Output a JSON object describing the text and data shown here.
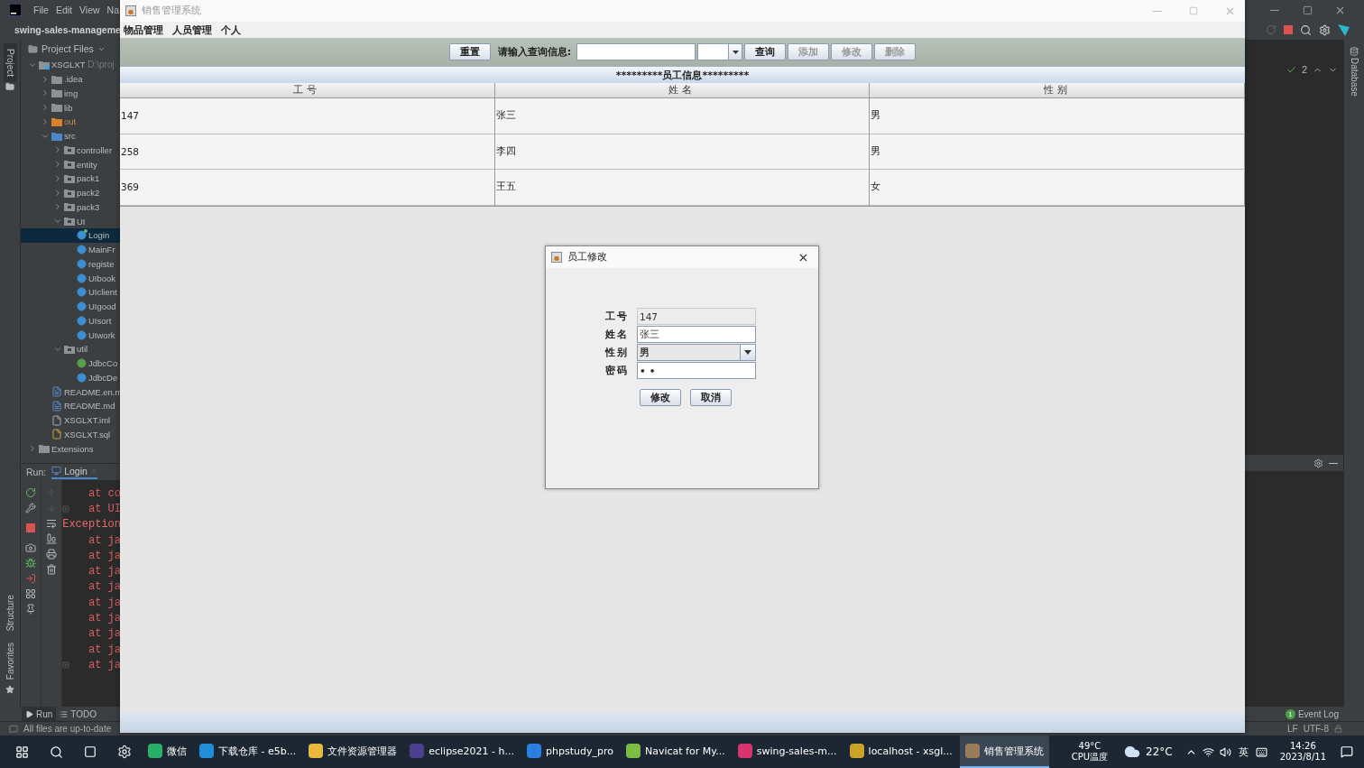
{
  "ide": {
    "menu": [
      "File",
      "Edit",
      "View",
      "Na"
    ],
    "project_title": "swing-sales-manageme",
    "side_tabs": [
      {
        "label": "Project",
        "selected": true
      },
      {
        "label": "Structure",
        "selected": false
      },
      {
        "label": "Favorites",
        "selected": false
      }
    ],
    "project_header": "Project Files",
    "tree": [
      {
        "label": "XSGLXT",
        "path": "D:\\proj",
        "kind": "module",
        "expanded": true,
        "selected": false,
        "children": [
          {
            "label": ".idea",
            "kind": "folder",
            "expanded": false,
            "selected": false
          },
          {
            "label": "img",
            "kind": "folder",
            "expanded": false,
            "selected": false
          },
          {
            "label": "lib",
            "kind": "folder",
            "expanded": false,
            "selected": false
          },
          {
            "label": "out",
            "kind": "excluded",
            "expanded": false,
            "selected": false
          },
          {
            "label": "src",
            "kind": "source",
            "expanded": true,
            "selected": false,
            "children": [
              {
                "label": "controller",
                "kind": "package",
                "expanded": false,
                "selected": false
              },
              {
                "label": "entity",
                "kind": "package",
                "expanded": false,
                "selected": false
              },
              {
                "label": "pack1",
                "kind": "package",
                "expanded": false,
                "selected": false
              },
              {
                "label": "pack2",
                "kind": "package",
                "expanded": false,
                "selected": false
              },
              {
                "label": "pack3",
                "kind": "package",
                "expanded": false,
                "selected": false
              },
              {
                "label": "UI",
                "kind": "package",
                "expanded": true,
                "selected": false,
                "children": [
                  {
                    "label": "Login",
                    "kind": "class",
                    "running": true,
                    "selected": true
                  },
                  {
                    "label": "MainFr",
                    "kind": "class",
                    "running": false,
                    "selected": false
                  },
                  {
                    "label": "registe",
                    "kind": "class",
                    "running": false,
                    "selected": false
                  },
                  {
                    "label": "UIbook",
                    "kind": "class",
                    "running": false,
                    "selected": false
                  },
                  {
                    "label": "UIclient",
                    "kind": "class",
                    "running": false,
                    "selected": false
                  },
                  {
                    "label": "UIgood",
                    "kind": "class",
                    "running": false,
                    "selected": false
                  },
                  {
                    "label": "UIsort",
                    "kind": "class",
                    "running": false,
                    "selected": false
                  },
                  {
                    "label": "UIwork",
                    "kind": "class",
                    "running": false,
                    "selected": false
                  }
                ]
              },
              {
                "label": "util",
                "kind": "package",
                "expanded": true,
                "selected": false,
                "children": [
                  {
                    "label": "JdbcCo",
                    "kind": "class-alt",
                    "running": false,
                    "selected": false
                  },
                  {
                    "label": "JdbcDe",
                    "kind": "class",
                    "running": false,
                    "selected": false
                  }
                ]
              }
            ]
          },
          {
            "label": "README.en.m",
            "kind": "markdown",
            "selected": false
          },
          {
            "label": "README.md",
            "kind": "markdown",
            "selected": false
          },
          {
            "label": "XSGLXT.iml",
            "kind": "iml",
            "selected": false
          },
          {
            "label": "XSGLXT.sql",
            "kind": "sql",
            "selected": false
          }
        ]
      },
      {
        "label": "Extensions",
        "kind": "folder",
        "expanded": false,
        "selected": false
      }
    ],
    "run": {
      "label": "Run:",
      "tab": "Login",
      "console": [
        {
          "kind": "frame",
          "text": "at co",
          "fold": false
        },
        {
          "kind": "frame",
          "text": "at UI",
          "fold": true
        },
        {
          "kind": "exception",
          "text": "Exception",
          "fold": false
        },
        {
          "kind": "frame",
          "text": "at ja",
          "fold": false
        },
        {
          "kind": "frame",
          "text": "at ja",
          "fold": false
        },
        {
          "kind": "frame",
          "text": "at ja",
          "fold": false
        },
        {
          "kind": "frame",
          "text": "at ja",
          "fold": false
        },
        {
          "kind": "frame",
          "text": "at ja",
          "fold": false
        },
        {
          "kind": "frame",
          "text": "at ja",
          "fold": false
        },
        {
          "kind": "frame",
          "text": "at ja",
          "fold": false
        },
        {
          "kind": "frame",
          "text": "at ja",
          "fold": false
        },
        {
          "kind": "frame",
          "text": "at ja",
          "fold": true
        }
      ]
    },
    "bottom_tabs": [
      {
        "label": "Run",
        "selected": true
      },
      {
        "label": "TODO",
        "selected": false
      }
    ],
    "status": "All files are up-to-date",
    "inspection_count": "2",
    "right_tab": "Database",
    "event_log": {
      "label": "Event Log",
      "count": "1"
    },
    "encoding": [
      "LF",
      "UTF-8"
    ]
  },
  "app": {
    "title": "销售管理系统",
    "menus": [
      "物品管理",
      "人员管理",
      "个人"
    ],
    "reset_button": {
      "label": "重置",
      "disabled": false
    },
    "query_label": "请输入查询信息:",
    "buttons": [
      {
        "label": "查询",
        "disabled": false
      },
      {
        "label": "添加",
        "disabled": true
      },
      {
        "label": "修改",
        "disabled": true
      },
      {
        "label": "删除",
        "disabled": true
      }
    ],
    "section_title": "*********员工信息*********",
    "table": {
      "columns": [
        "工号",
        "姓名",
        "性别"
      ],
      "rows": [
        [
          "147",
          "张三",
          "男"
        ],
        [
          "258",
          "李四",
          "男"
        ],
        [
          "369",
          "王五",
          "女"
        ]
      ]
    }
  },
  "dialog": {
    "title": "员工修改",
    "fields": [
      {
        "kind": "text",
        "label": "工号",
        "value": "147",
        "disabled": true
      },
      {
        "kind": "text",
        "label": "姓名",
        "value": "张三",
        "disabled": false
      },
      {
        "kind": "select",
        "label": "性别",
        "value": "男",
        "disabled": false
      },
      {
        "kind": "password",
        "label": "密码",
        "value": "••",
        "disabled": false
      }
    ],
    "buttons": [
      "修改",
      "取消"
    ]
  },
  "taskbar": {
    "apps": [
      {
        "label": "微信",
        "color": "#2aae67",
        "selected": false
      },
      {
        "label": "下载仓库 - e5b...",
        "color": "#1f8fd8",
        "selected": false
      },
      {
        "label": "文件资源管理器",
        "color": "#e8b93c",
        "selected": false
      },
      {
        "label": "eclipse2021 - h...",
        "color": "#4b3f8f",
        "selected": false
      },
      {
        "label": "phpstudy_pro",
        "color": "#2a7fe0",
        "selected": false
      },
      {
        "label": "Navicat for My...",
        "color": "#7dbb42",
        "selected": false
      },
      {
        "label": "swing-sales-m...",
        "color": "#d7336f",
        "selected": false
      },
      {
        "label": "localhost - xsgl...",
        "color": "#c9a227",
        "selected": false
      },
      {
        "label": "销售管理系统",
        "color": "#9a7b5a",
        "selected": true
      }
    ],
    "cpu_temp": "49°C",
    "cpu_label": "CPU温度",
    "weather": "22°C",
    "ime": "英",
    "time": "14:26",
    "date": "2023/8/11"
  }
}
